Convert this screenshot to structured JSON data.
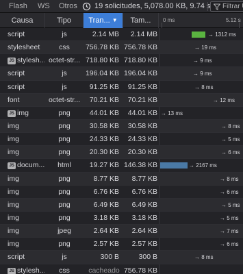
{
  "toolbar": {
    "tabs": [
      "Flash",
      "WS",
      "Otros"
    ],
    "summary": "19 solicitudes, 5,078.00 KB, 9.74 s",
    "filter_placeholder": "Filtrar U"
  },
  "columns": {
    "cause": "Causa",
    "type": "Tipo",
    "transferred": "Tran...",
    "size": "Tam...",
    "wf_start": "0 ms",
    "wf_end": "5.12 s"
  },
  "colors": {
    "background": "#232327",
    "sorted_header": "#3d7ed8",
    "bar_green": "#5ab440",
    "bar_blue": "#4a79a5"
  },
  "rows": [
    {
      "cause": "script",
      "badge": false,
      "type": "js",
      "transferred": "2.14 MB",
      "size": "2.14 MB",
      "time": "→ 1312 ms",
      "bar": "green"
    },
    {
      "cause": "stylesheet",
      "badge": false,
      "type": "css",
      "transferred": "756.78 KB",
      "size": "756.78 KB",
      "time": "→ 19 ms",
      "bar": null
    },
    {
      "cause": "stylesh...",
      "badge": true,
      "type": "octet-str...",
      "transferred": "718.80 KB",
      "size": "718.80 KB",
      "time": "→ 9 ms",
      "bar": null
    },
    {
      "cause": "script",
      "badge": false,
      "type": "js",
      "transferred": "196.04 KB",
      "size": "196.04 KB",
      "time": "→ 9 ms",
      "bar": null
    },
    {
      "cause": "script",
      "badge": false,
      "type": "js",
      "transferred": "91.25 KB",
      "size": "91.25 KB",
      "time": "→ 8 ms",
      "bar": null
    },
    {
      "cause": "font",
      "badge": false,
      "type": "octet-str...",
      "transferred": "70.21 KB",
      "size": "70.21 KB",
      "time": "→ 12 ms",
      "bar": null
    },
    {
      "cause": "img",
      "badge": true,
      "type": "png",
      "transferred": "44.01 KB",
      "size": "44.01 KB",
      "time": "→ 13 ms",
      "bar": null
    },
    {
      "cause": "img",
      "badge": false,
      "type": "png",
      "transferred": "30.58 KB",
      "size": "30.58 KB",
      "time": "→ 8 ms",
      "bar": null
    },
    {
      "cause": "img",
      "badge": false,
      "type": "png",
      "transferred": "24.33 KB",
      "size": "24.33 KB",
      "time": "→ 5 ms",
      "bar": null
    },
    {
      "cause": "img",
      "badge": false,
      "type": "png",
      "transferred": "20.30 KB",
      "size": "20.30 KB",
      "time": "→ 6 ms",
      "bar": null
    },
    {
      "cause": "docum...",
      "badge": true,
      "type": "html",
      "transferred": "19.27 KB",
      "size": "146.38 KB",
      "time": "→ 2167 ms",
      "bar": "blue"
    },
    {
      "cause": "img",
      "badge": false,
      "type": "png",
      "transferred": "8.77 KB",
      "size": "8.77 KB",
      "time": "→ 8 ms",
      "bar": null
    },
    {
      "cause": "img",
      "badge": false,
      "type": "png",
      "transferred": "6.76 KB",
      "size": "6.76 KB",
      "time": "→ 6 ms",
      "bar": null
    },
    {
      "cause": "img",
      "badge": false,
      "type": "png",
      "transferred": "6.49 KB",
      "size": "6.49 KB",
      "time": "→ 5 ms",
      "bar": null
    },
    {
      "cause": "img",
      "badge": false,
      "type": "png",
      "transferred": "3.18 KB",
      "size": "3.18 KB",
      "time": "→ 5 ms",
      "bar": null
    },
    {
      "cause": "img",
      "badge": false,
      "type": "jpeg",
      "transferred": "2.64 KB",
      "size": "2.64 KB",
      "time": "→ 7 ms",
      "bar": null
    },
    {
      "cause": "img",
      "badge": false,
      "type": "png",
      "transferred": "2.57 KB",
      "size": "2.57 KB",
      "time": "→ 6 ms",
      "bar": null
    },
    {
      "cause": "script",
      "badge": false,
      "type": "js",
      "transferred": "300 B",
      "size": "300 B",
      "time": "→ 8 ms",
      "bar": null
    },
    {
      "cause": "stylesh...",
      "badge": true,
      "type": "css",
      "transferred": "cacheado",
      "size": "756.78 KB",
      "time": "",
      "bar": null,
      "cached": true
    }
  ]
}
